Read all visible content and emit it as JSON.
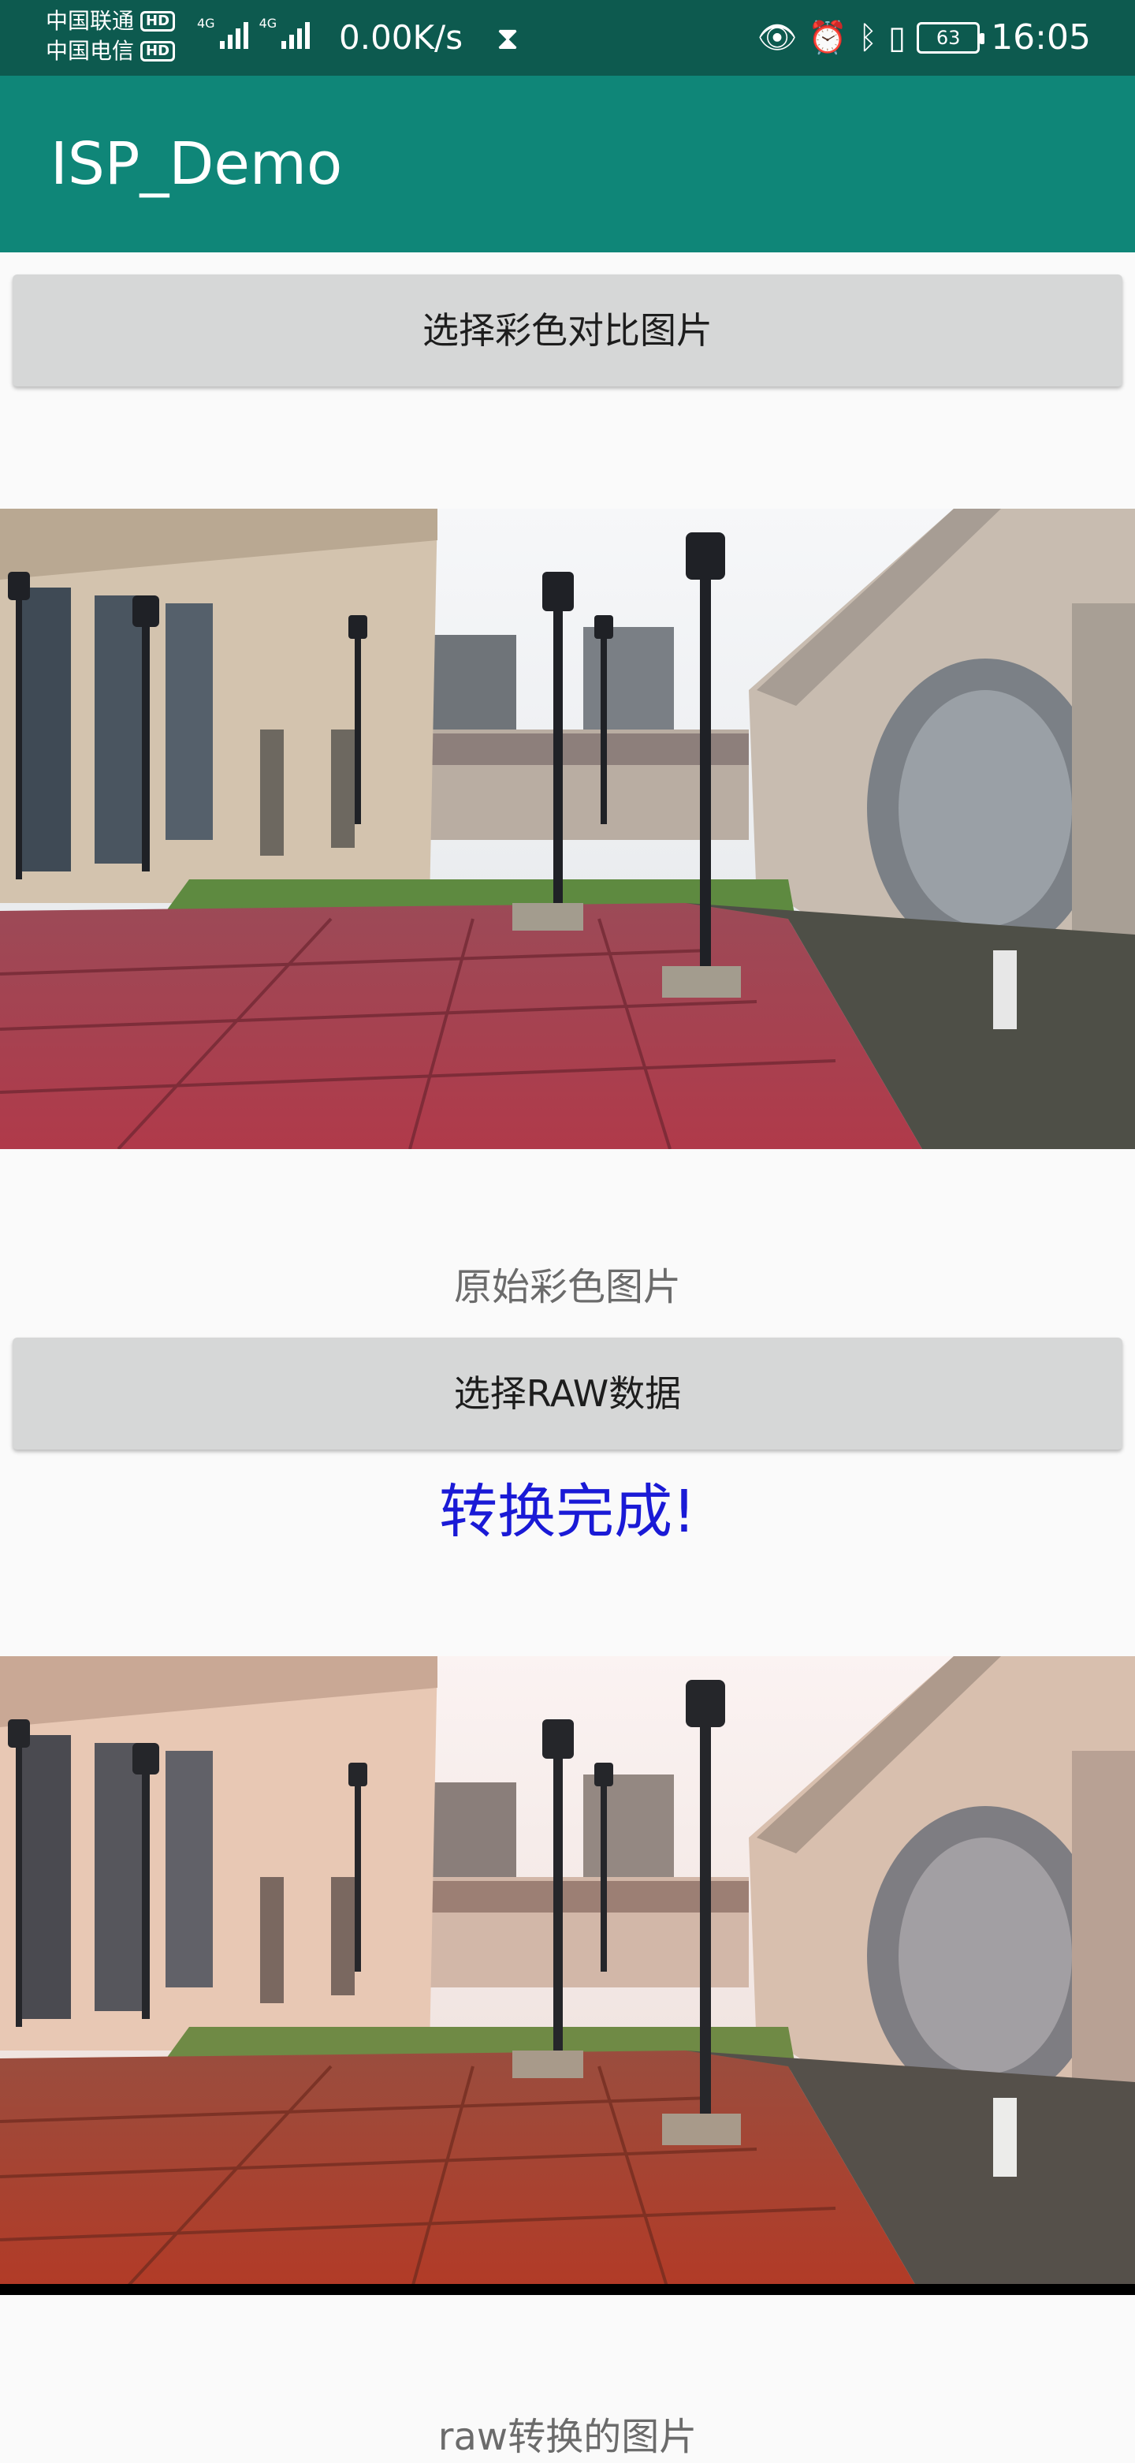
{
  "status_bar": {
    "carrier_1": "中国联通",
    "carrier_2": "中国电信",
    "hd_badge": "HD",
    "network_type_1": "4G",
    "network_type_2": "4G",
    "speed": "0.00K/s",
    "battery": "63",
    "time": "16:05"
  },
  "app_bar": {
    "title": "ISP_Demo"
  },
  "main": {
    "select_color_button": "选择彩色对比图片",
    "original_caption": "原始彩色图片",
    "select_raw_button": "选择RAW数据",
    "status_message": "转换完成!",
    "raw_caption": "raw转换的图片"
  },
  "colors": {
    "status_bar": "#0d5a4f",
    "app_bar": "#0f8678",
    "button": "#d6d7d7",
    "status_message": "#1a1ad6"
  }
}
